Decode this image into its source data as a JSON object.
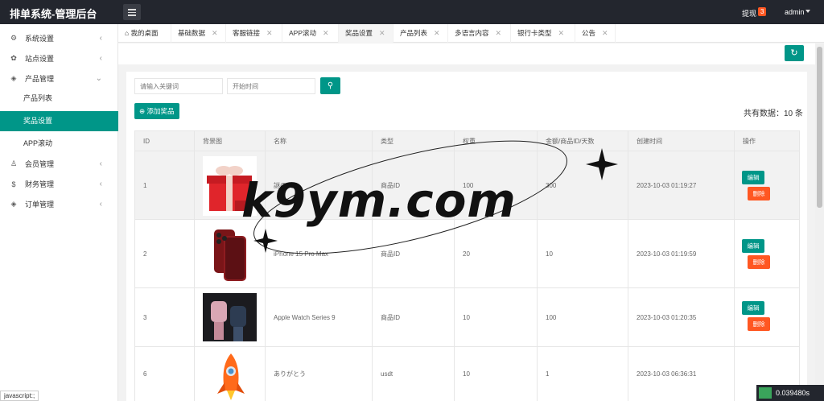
{
  "app": {
    "title": "排单系统-管理后台",
    "withdraw_label": "提现",
    "withdraw_count": "3",
    "user": "admin"
  },
  "sidebar": {
    "items": [
      {
        "label": "系统设置",
        "icon": "gear-icon"
      },
      {
        "label": "站点设置",
        "icon": "site-icon"
      },
      {
        "label": "产品管理",
        "icon": "layers-icon"
      },
      {
        "label": "产品列表"
      },
      {
        "label": "奖品设置"
      },
      {
        "label": "APP滚动"
      },
      {
        "label": "会员管理",
        "icon": "user-icon"
      },
      {
        "label": "财务管理",
        "icon": "dollar-icon"
      },
      {
        "label": "订单管理",
        "icon": "layers-icon"
      }
    ]
  },
  "tabs": [
    {
      "label": "我的桌面"
    },
    {
      "label": "基础数据"
    },
    {
      "label": "客服链接"
    },
    {
      "label": "APP滚动"
    },
    {
      "label": "奖品设置"
    },
    {
      "label": "产品列表"
    },
    {
      "label": "多语言内容"
    },
    {
      "label": "银行卡类型"
    },
    {
      "label": "公告"
    }
  ],
  "search": {
    "keyword_placeholder": "请输入关键词",
    "start_time_placeholder": "开始时间"
  },
  "add_button": "添加奖品",
  "total_text": "共有数据：10 条",
  "table": {
    "headers": [
      "ID",
      "背景图",
      "名称",
      "类型",
      "权重",
      "金额/商品ID/天数",
      "创建时间",
      "操作"
    ],
    "edit_label": "编辑",
    "delete_label": "删除",
    "rows": [
      {
        "id": "1",
        "name": "謎の大",
        "type": "商品ID",
        "weight": "100",
        "amount": "300",
        "created": "2023-10-03 01:19:27"
      },
      {
        "id": "2",
        "name": "iPhone 15 Pro Max",
        "type": "商品ID",
        "weight": "20",
        "amount": "10",
        "created": "2023-10-03 01:19:59"
      },
      {
        "id": "3",
        "name": "Apple Watch Series 9",
        "type": "商品ID",
        "weight": "10",
        "amount": "100",
        "created": "2023-10-03 01:20:35"
      },
      {
        "id": "6",
        "name": "ありがとう",
        "type": "usdt",
        "weight": "10",
        "amount": "1",
        "created": "2023-10-03 06:36:31"
      }
    ]
  },
  "watermark": "k9ym.com",
  "status_bar": "javascript:;",
  "timer": "0.039480s",
  "colors": {
    "primary": "#009688",
    "danger": "#ff5722",
    "topbar": "#23262e"
  }
}
